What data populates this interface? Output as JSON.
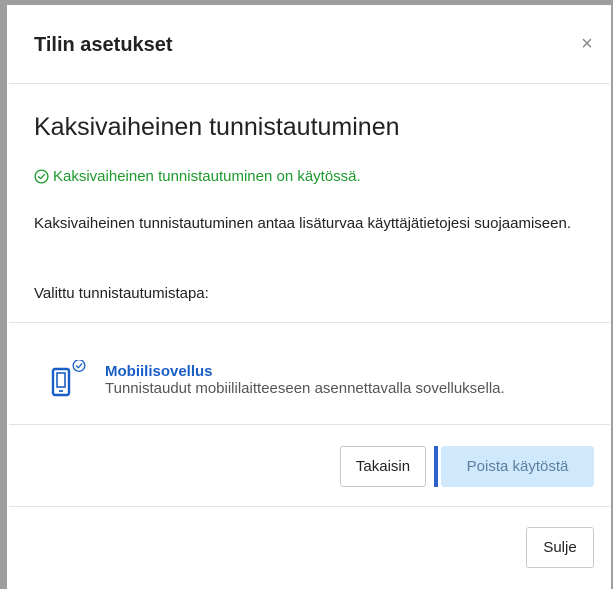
{
  "dialog": {
    "title": "Tilin asetukset",
    "close_symbol": "×"
  },
  "two_factor": {
    "heading": "Kaksivaiheinen tunnistautuminen",
    "status": "Kaksivaiheinen tunnistautuminen on käytössä.",
    "description": "Kaksivaiheinen tunnistautuminen antaa lisäturvaa käyttäjätietojesi suojaamiseen.",
    "method_label": "Valittu tunnistautumistapa:",
    "method": {
      "name": "Mobiilisovellus",
      "description": "Tunnistaudut mobiililaitteeseen asennettavalla sovelluksella.",
      "icon": "phone-icon",
      "badge_icon": "check-circle-icon"
    }
  },
  "buttons": {
    "back": "Takaisin",
    "disable": "Poista käytöstä",
    "close": "Sulje"
  },
  "colors": {
    "success": "#1f9a2e",
    "accent": "#1a5fc7",
    "disable_bg": "#cfe8fb"
  }
}
